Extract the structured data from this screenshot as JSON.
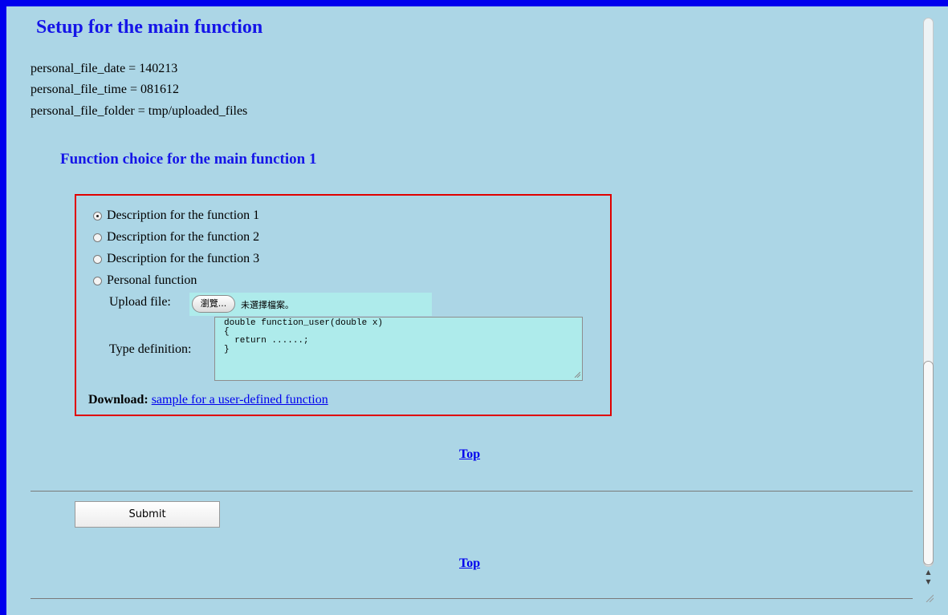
{
  "header": {
    "title": "Setup for the main function"
  },
  "info": [
    {
      "text": "personal_file_date = 140213"
    },
    {
      "text": "personal_file_time = 081612"
    },
    {
      "text": "personal_file_folder = tmp/uploaded_files"
    }
  ],
  "section": {
    "title": "Function choice for the main function 1"
  },
  "choices": [
    {
      "label": "Description for the function 1",
      "checked": true
    },
    {
      "label": "Description for the function 2",
      "checked": false
    },
    {
      "label": "Description for the function 3",
      "checked": false
    },
    {
      "label": "Personal function",
      "checked": false
    }
  ],
  "upload": {
    "label": "Upload file:",
    "button_label": "瀏覽...",
    "status": "未選擇檔案。"
  },
  "type_definition": {
    "label": "Type definition:",
    "value": "double function_user(double x)\n{\n  return ......;\n}"
  },
  "download": {
    "label": "Download:",
    "link_text": "sample for a user-defined function"
  },
  "nav": {
    "top_label": "Top"
  },
  "form": {
    "submit_label": "Submit"
  },
  "colors": {
    "page_background": "#acd6e6",
    "title_color": "#1515e8",
    "box_border": "#e00000",
    "window_border": "#0000ee"
  },
  "icons": [
    "radio-selected-icon",
    "radio-unselected-icon",
    "resize-grip-icon",
    "scroll-up-arrow-icon",
    "scroll-down-arrow-icon"
  ]
}
